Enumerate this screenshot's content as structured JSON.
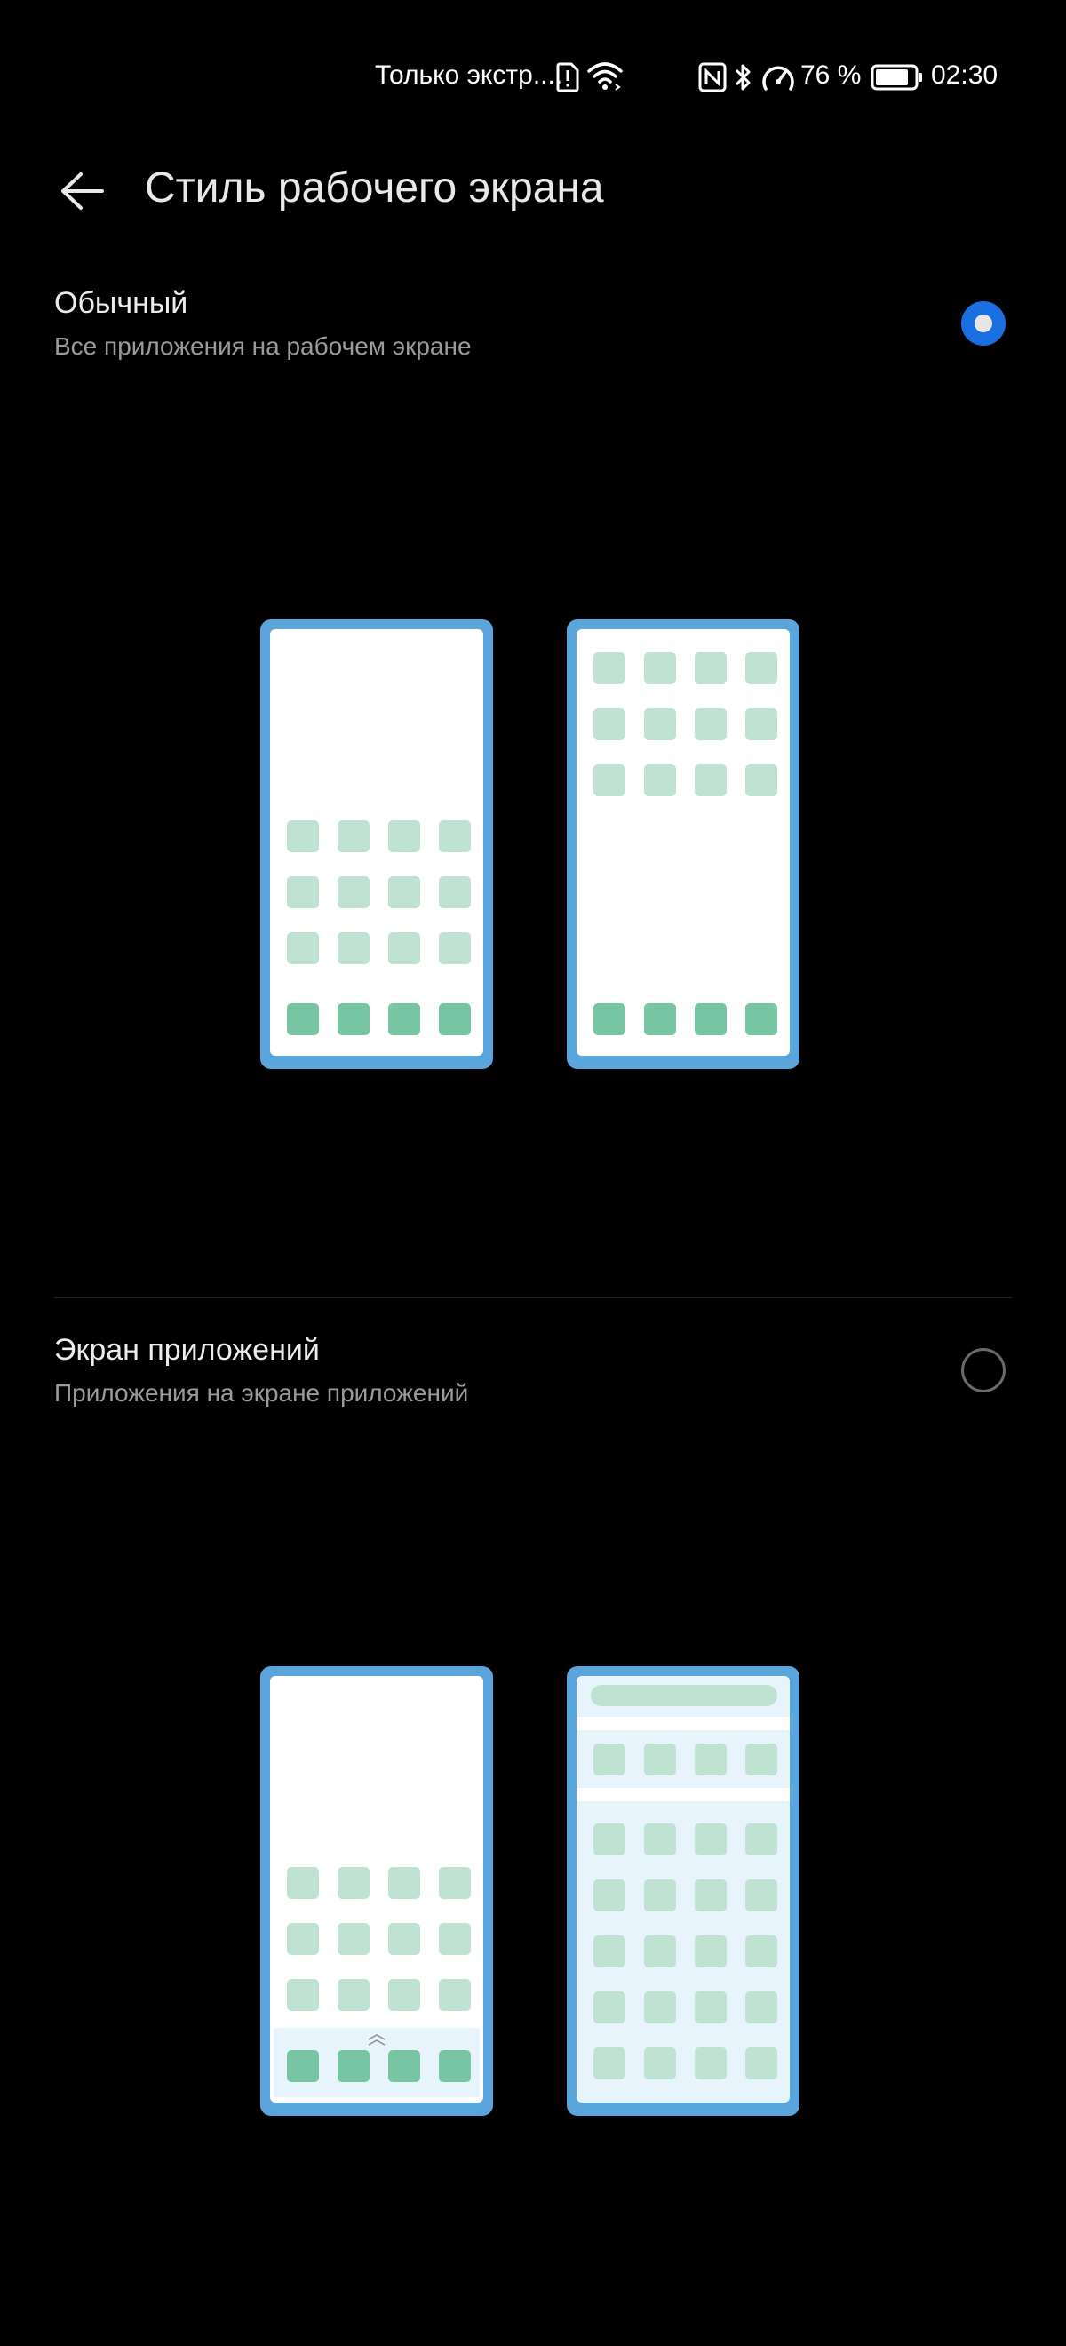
{
  "status_bar": {
    "carrier_text": "Только экстр....",
    "battery_percent": "76 %",
    "time": "02:30",
    "icons": [
      "alert-sim-icon",
      "wifi-icon",
      "nfc-icon",
      "bluetooth-icon",
      "speedometer-icon",
      "battery-icon"
    ]
  },
  "header": {
    "title": "Стиль рабочего экрана",
    "back_icon": "back-arrow-icon"
  },
  "options": [
    {
      "title": "Обычный",
      "subtitle": "Все приложения на рабочем экране",
      "selected": true
    },
    {
      "title": "Экран приложений",
      "subtitle": "Приложения на экране приложений",
      "selected": false
    }
  ],
  "colors": {
    "accent": "#1a6fe0",
    "phone_frame": "#5aa5dc",
    "phone_screen": "#ffffff",
    "drawer_screen": "#e8f4fb",
    "icon_light": "#bfe2d2",
    "icon_dark": "#77c5a2"
  }
}
